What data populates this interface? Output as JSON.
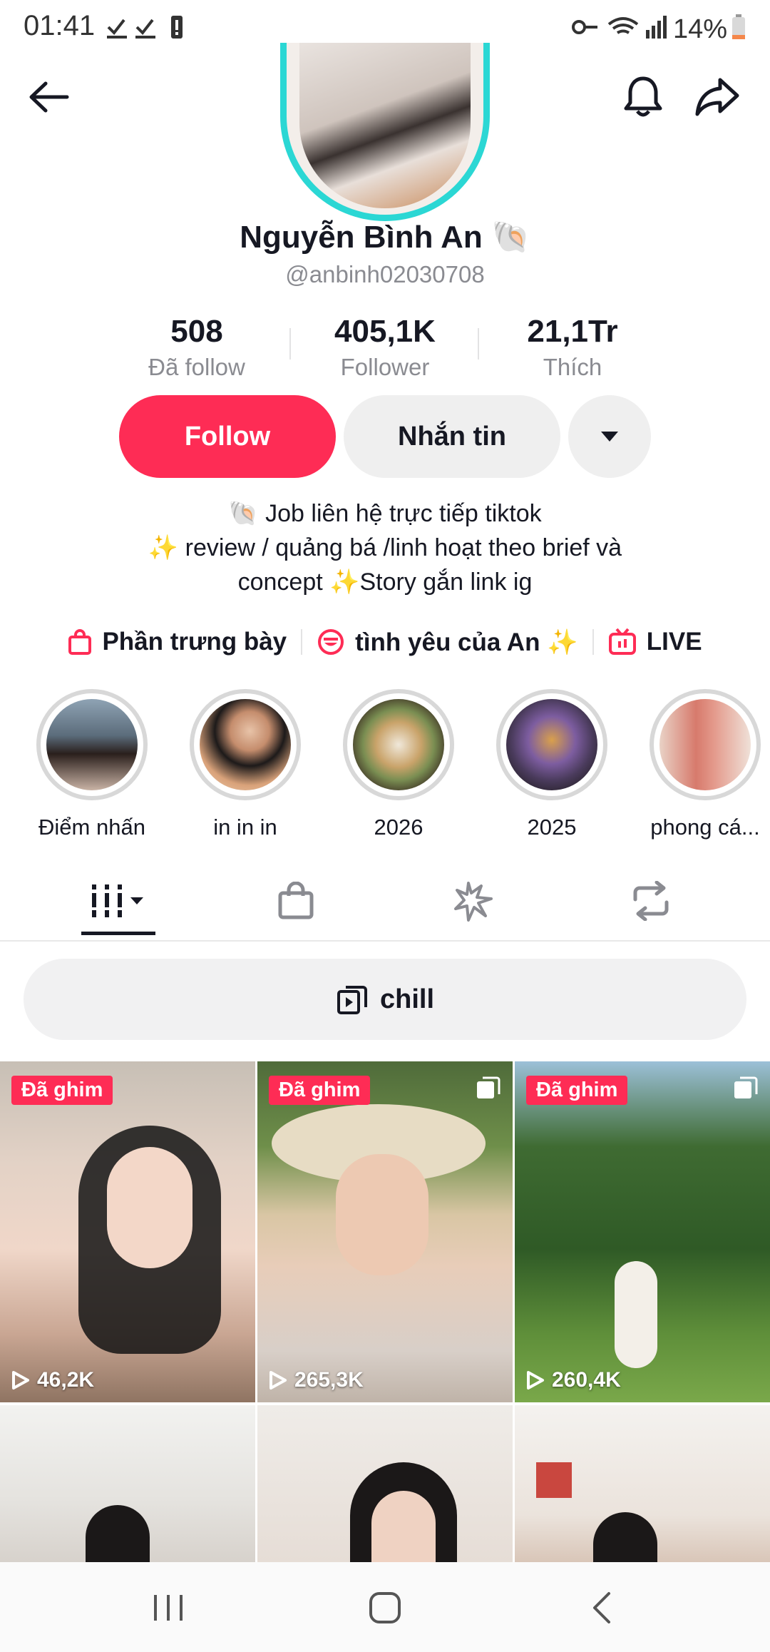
{
  "status": {
    "time": "01:41",
    "battery": "14%"
  },
  "profile": {
    "name": "Nguyễn Bình An 🐚",
    "handle": "@anbinh02030708"
  },
  "stats": [
    {
      "value": "508",
      "label": "Đã follow"
    },
    {
      "value": "405,1K",
      "label": "Follower"
    },
    {
      "value": "21,1Tr",
      "label": "Thích"
    }
  ],
  "actions": {
    "follow": "Follow",
    "message": "Nhắn tin"
  },
  "bio": {
    "line1": "🐚 Job liên hệ trực tiếp tiktok",
    "line2": "✨ review / quảng bá /linh hoạt theo brief và",
    "line3": "concept ✨Story gắn link ig"
  },
  "links": [
    {
      "label": "Phần trưng bày",
      "icon": "shopping-bag-icon"
    },
    {
      "label": "tình yêu của An ✨",
      "icon": "smile-badge-icon"
    },
    {
      "label": "LIVE",
      "icon": "live-tv-icon"
    }
  ],
  "highlights": [
    {
      "label": "Điểm nhấn"
    },
    {
      "label": "in in in"
    },
    {
      "label": "2026"
    },
    {
      "label": "2025"
    },
    {
      "label": "phong cá..."
    }
  ],
  "playlist": {
    "label": "chill"
  },
  "videos": [
    {
      "pinned": "Đã ghim",
      "views": "46,2K"
    },
    {
      "pinned": "Đã ghim",
      "views": "265,3K"
    },
    {
      "pinned": "Đã ghim",
      "views": "260,4K"
    },
    {
      "pinned": "",
      "views": ""
    },
    {
      "pinned": "",
      "views": ""
    },
    {
      "pinned": "",
      "views": ""
    }
  ],
  "colors": {
    "accent": "#fe2c55",
    "ring": "#2bd7d4"
  }
}
